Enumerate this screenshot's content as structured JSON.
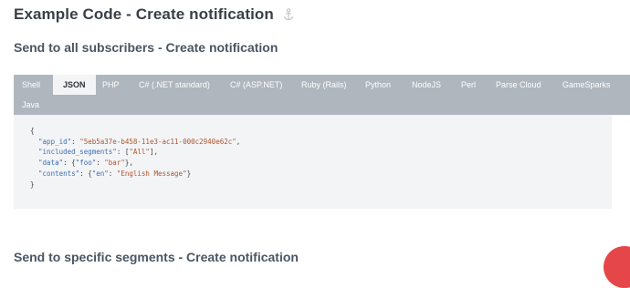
{
  "page": {
    "title": "Example Code - Create notification",
    "section_title": "Send to all subscribers - Create notification",
    "partial_section_title": "Send to specific segments - Create notification"
  },
  "tabs": [
    {
      "label": "Shell",
      "active": false
    },
    {
      "label": "JSON",
      "active": true
    },
    {
      "label": "PHP",
      "active": false
    },
    {
      "label": "C# (.NET standard)",
      "active": false
    },
    {
      "label": "C# (ASP.NET)",
      "active": false
    },
    {
      "label": "Ruby (Rails)",
      "active": false
    },
    {
      "label": "Python",
      "active": false
    },
    {
      "label": "NodeJS",
      "active": false
    },
    {
      "label": "Perl",
      "active": false
    },
    {
      "label": "Parse Cloud",
      "active": false
    },
    {
      "label": "GameSparks",
      "active": false
    },
    {
      "label": "Java",
      "active": false
    }
  ],
  "code": {
    "open_brace": "{",
    "app_id_key": "\"app_id\"",
    "app_id_value": "\"5eb5a37e-b458-11e3-ac11-000c2940e62c\"",
    "segments_key": "\"included_segments\"",
    "segments_value": "\"All\"",
    "data_key": "\"data\"",
    "data_inner_key": "\"foo\"",
    "data_inner_value": "\"bar\"",
    "contents_key": "\"contents\"",
    "contents_inner_key": "\"en\"",
    "contents_inner_value": "\"English Message\"",
    "close_brace": "}"
  },
  "colors": {
    "tab_bar": "#b0b6bd",
    "code_bg": "#f3f4f6",
    "fab": "#e4464a"
  }
}
